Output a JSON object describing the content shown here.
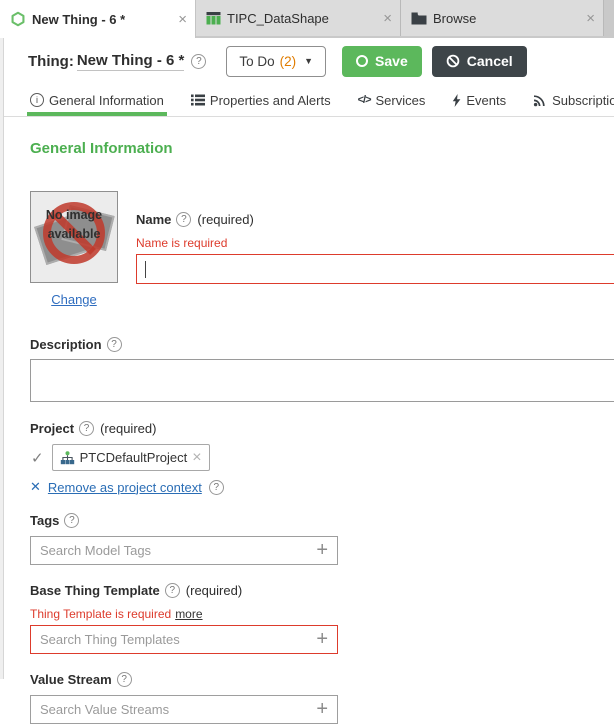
{
  "colors": {
    "accent_green": "#5cb85c",
    "heading_green": "#4caf50",
    "error_red": "#dd3b2c",
    "link_blue": "#2a6db5",
    "todo_orange": "#e07c00",
    "cancel_dark": "#3e4549"
  },
  "icons": {
    "help": "?",
    "close": "×",
    "plus": "+",
    "check": "✓",
    "remove_x": "✕",
    "caret_down": "▼",
    "code": "</>",
    "info": "i"
  },
  "window_tabs": [
    {
      "label": "New Thing - 6 *",
      "icon": "thing-hexagon-icon",
      "active": true
    },
    {
      "label": "TIPC_DataShape",
      "icon": "datashape-icon",
      "active": false
    },
    {
      "label": "Browse",
      "icon": "folder-icon",
      "active": false
    }
  ],
  "header": {
    "type_label": "Thing:",
    "name_value": "New Thing - 6 *",
    "todo": {
      "label": "To Do",
      "count": "(2)"
    },
    "save_label": "Save",
    "cancel_label": "Cancel"
  },
  "nav_tabs": [
    {
      "label": "General Information",
      "icon": "info-icon",
      "active": true
    },
    {
      "label": "Properties and Alerts",
      "icon": "list-icon",
      "active": false
    },
    {
      "label": "Services",
      "icon": "code-icon",
      "active": false
    },
    {
      "label": "Events",
      "icon": "bolt-icon",
      "active": false
    },
    {
      "label": "Subscriptions",
      "icon": "subscriptions-icon",
      "active": false
    }
  ],
  "content": {
    "heading": "General Information",
    "image": {
      "placeholder_text": "No image available",
      "change_label": "Change"
    },
    "name": {
      "label": "Name",
      "required_suffix": "(required)",
      "error": "Name is required",
      "value": ""
    },
    "description": {
      "label": "Description",
      "value": ""
    },
    "project": {
      "label": "Project",
      "required_suffix": "(required)",
      "chip_label": "PTCDefaultProject",
      "remove_link": "Remove as project context"
    },
    "tags": {
      "label": "Tags",
      "placeholder": "Search Model Tags",
      "value": ""
    },
    "base_template": {
      "label": "Base Thing Template",
      "required_suffix": "(required)",
      "error": "Thing Template is required",
      "error_more": "more",
      "placeholder": "Search Thing Templates",
      "value": ""
    },
    "value_stream": {
      "label": "Value Stream",
      "placeholder": "Search Value Streams",
      "value": ""
    }
  }
}
